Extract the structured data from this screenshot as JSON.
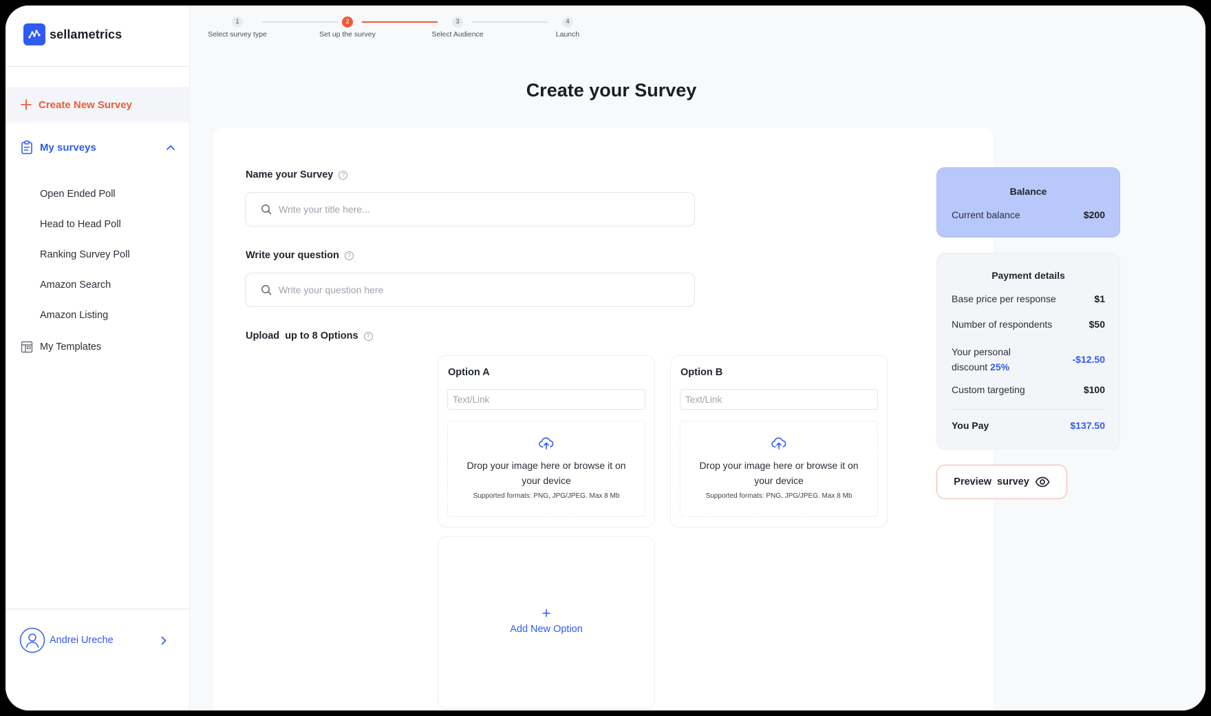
{
  "brand": {
    "name": "sellametrics",
    "accent": "#2f5cf0",
    "orange": "#e85d37"
  },
  "sidebar": {
    "create_label": "Create New Survey",
    "my_surveys_label": "My surveys",
    "survey_types": [
      "Open Ended Poll",
      "Head to Head Poll",
      "Ranking Survey Poll",
      "Amazon Search",
      "Amazon Listing"
    ],
    "templates_label": "My Templates",
    "user_name": "Andrei Ureche"
  },
  "stepper": {
    "current_step": 2,
    "steps": [
      {
        "number": "1",
        "label": "Select survey type"
      },
      {
        "number": "2",
        "label": "Set up the survey"
      },
      {
        "number": "3",
        "label": "Select Audience"
      },
      {
        "number": "4",
        "label": "Launch"
      }
    ]
  },
  "page": {
    "title": "Create your Survey"
  },
  "form": {
    "name_label": "Name your Survey",
    "name_placeholder": "Write your title here...",
    "question_label": "Write your question",
    "question_placeholder": "Write your question here",
    "options_label": "Upload  up to 8 Options",
    "options": [
      {
        "title": "Option A",
        "placeholder": "Text/Link"
      },
      {
        "title": "Option B",
        "placeholder": "Text/Link"
      }
    ],
    "drop_text": "Drop your image here or browse it on your device",
    "drop_formats": "Supported formats: PNG, JPG/JPEG. Max 8 Mb",
    "add_option_label": "Add New Option"
  },
  "balance": {
    "title": "Balance",
    "label": "Current balance",
    "value": "$200"
  },
  "payment": {
    "title": "Payment details",
    "base_label": "Base price per response",
    "base_value": "$1",
    "respondents_label": "Number of respondents",
    "respondents_value": "$50",
    "discount_label": "Your personal",
    "discount_label2": "discount",
    "discount_pct": "25%",
    "discount_value": "-$12.50",
    "targeting_label": "Custom targeting",
    "targeting_value": "$100",
    "total_label": "You Pay",
    "total_value": "$137.50"
  },
  "preview": {
    "label": "Preview  survey"
  }
}
